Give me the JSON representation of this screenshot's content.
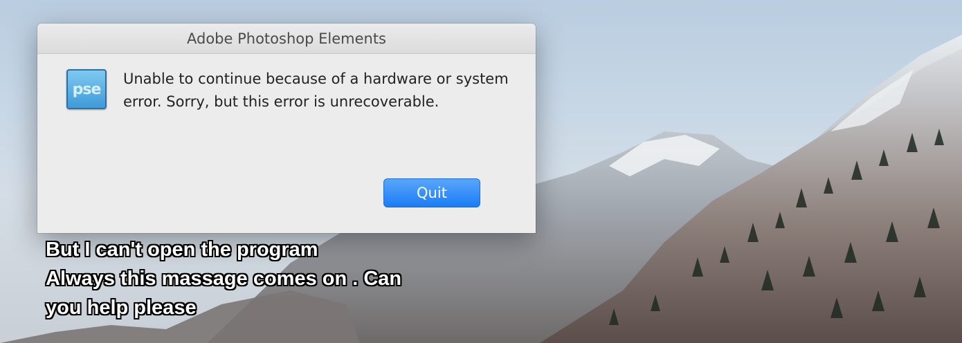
{
  "dialog": {
    "title": "Adobe Photoshop Elements",
    "app_icon_text": "pse",
    "message": "Unable to continue because of a hardware or system error. Sorry, but this error is unrecoverable.",
    "quit_label": "Quit"
  },
  "caption": {
    "text": "But I can't open the program\nAlways this massage comes on . Can\nyou help please"
  },
  "colors": {
    "button_accent": "#1b7cf3",
    "icon_blue": "#3e9ad8"
  },
  "icons": {
    "app": "photoshop-elements-app-icon"
  }
}
